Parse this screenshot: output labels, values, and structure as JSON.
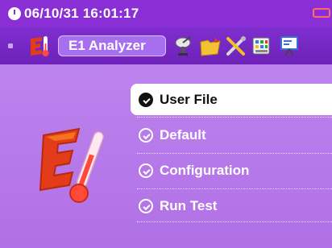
{
  "status_bar": {
    "datetime": "06/10/31  16:01:17"
  },
  "toolbar": {
    "app_title": "E1 Analyzer",
    "icons": [
      "thermometer-logo-icon",
      "satellite-dish-icon",
      "folder-icon",
      "tools-icon",
      "keypad-icon",
      "presentation-icon"
    ]
  },
  "menu": {
    "items": [
      {
        "label": "User File",
        "selected": true
      },
      {
        "label": "Default",
        "selected": false
      },
      {
        "label": "Configuration",
        "selected": false
      },
      {
        "label": "Run Test",
        "selected": false
      }
    ]
  },
  "colors": {
    "background": "#b777e8",
    "status_bar": "#8a2fd6",
    "toolbar": "#6d22b8",
    "logo_red": "#e23c1a",
    "logo_orange": "#ff8a1f"
  }
}
